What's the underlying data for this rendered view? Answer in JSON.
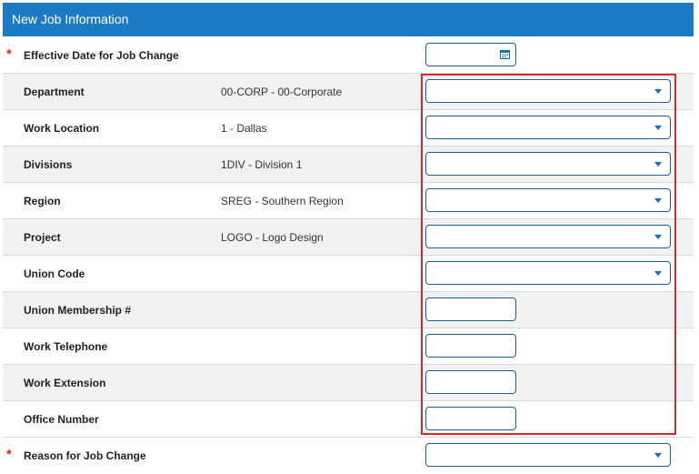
{
  "panel": {
    "title": "New Job Information"
  },
  "fields": [
    {
      "label": "Effective Date for Job Change",
      "required": true,
      "current": "",
      "control": "date"
    },
    {
      "label": "Department",
      "required": false,
      "current": "00-CORP - 00-Corporate",
      "control": "select"
    },
    {
      "label": "Work Location",
      "required": false,
      "current": "1 - Dallas",
      "control": "select"
    },
    {
      "label": "Divisions",
      "required": false,
      "current": "1DIV - Division 1",
      "control": "select"
    },
    {
      "label": "Region",
      "required": false,
      "current": "SREG - Southern Region",
      "control": "select"
    },
    {
      "label": "Project",
      "required": false,
      "current": "LOGO - Logo Design",
      "control": "select"
    },
    {
      "label": "Union Code",
      "required": false,
      "current": "",
      "control": "select"
    },
    {
      "label": "Union Membership #",
      "required": false,
      "current": "",
      "control": "text"
    },
    {
      "label": "Work Telephone",
      "required": false,
      "current": "",
      "control": "text"
    },
    {
      "label": "Work Extension",
      "required": false,
      "current": "",
      "control": "text"
    },
    {
      "label": "Office Number",
      "required": false,
      "current": "",
      "control": "text"
    },
    {
      "label": "Reason for Job Change",
      "required": true,
      "current": "",
      "control": "select"
    }
  ],
  "required_marker": "*",
  "colors": {
    "header": "#1a7bc4",
    "highlight": "#d42a2f",
    "required": "#d0281c",
    "control_border": "#1f5f8c"
  },
  "icons": {
    "date": "calendar-icon",
    "select": "chevron-down-icon"
  }
}
